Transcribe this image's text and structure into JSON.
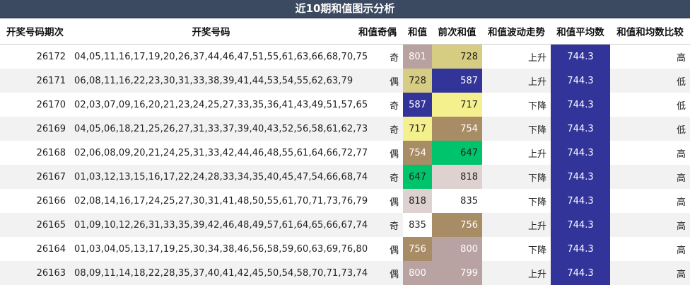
{
  "title": "近10期和值图示分析",
  "headers": {
    "period": "开奖号码期次",
    "numbers": "开奖号码",
    "parity": "和值奇偶",
    "sum": "和值",
    "prev_sum": "前次和值",
    "trend": "和值波动走势",
    "avg": "和值平均数",
    "compare": "和值和均数比较"
  },
  "colors": {
    "title_bg": "#3b4a60",
    "avg_bg": "#33349a",
    "row_alt": "#f2f2f2"
  },
  "rows": [
    {
      "period": "26172",
      "numbers": "04,05,11,16,17,19,20,26,37,44,46,47,51,55,61,63,66,68,70,75",
      "parity": "奇",
      "sum": "801",
      "sum_bg": "#b8a29f",
      "sum_fg": "#ffffff",
      "prev": "728",
      "prev_bg": "#d6cd82",
      "prev_fg": "#222222",
      "trend": "上升",
      "avg": "744.3",
      "compare": "高"
    },
    {
      "period": "26171",
      "numbers": "06,08,11,16,22,23,30,31,33,38,39,41,44,53,54,55,62,63,79",
      "parity": "偶",
      "sum": "728",
      "sum_bg": "#d6cd82",
      "sum_fg": "#222222",
      "prev": "587",
      "prev_bg": "#33349a",
      "prev_fg": "#ffffff",
      "trend": "上升",
      "avg": "744.3",
      "compare": "低"
    },
    {
      "period": "26170",
      "numbers": "02,03,07,09,16,20,21,23,24,25,27,33,35,36,41,43,49,51,57,65",
      "parity": "奇",
      "sum": "587",
      "sum_bg": "#33349a",
      "sum_fg": "#ffffff",
      "prev": "717",
      "prev_bg": "#f4f08e",
      "prev_fg": "#222222",
      "trend": "下降",
      "avg": "744.3",
      "compare": "低"
    },
    {
      "period": "26169",
      "numbers": "04,05,06,18,21,25,26,27,31,33,37,39,40,43,52,56,58,61,62,73",
      "parity": "奇",
      "sum": "717",
      "sum_bg": "#f4f08e",
      "sum_fg": "#222222",
      "prev": "754",
      "prev_bg": "#a88c66",
      "prev_fg": "#ffffff",
      "trend": "下降",
      "avg": "744.3",
      "compare": "低"
    },
    {
      "period": "26168",
      "numbers": "02,06,08,09,20,21,24,25,31,33,42,44,46,48,55,61,64,66,72,77",
      "parity": "偶",
      "sum": "754",
      "sum_bg": "#a88c66",
      "sum_fg": "#ffffff",
      "prev": "647",
      "prev_bg": "#00c46c",
      "prev_fg": "#222222",
      "trend": "上升",
      "avg": "744.3",
      "compare": "高"
    },
    {
      "period": "26167",
      "numbers": "01,03,12,13,15,16,17,22,24,28,33,34,35,40,45,47,54,66,68,74",
      "parity": "奇",
      "sum": "647",
      "sum_bg": "#00c46c",
      "sum_fg": "#222222",
      "prev": "818",
      "prev_bg": "#ddd2cf",
      "prev_fg": "#222222",
      "trend": "下降",
      "avg": "744.3",
      "compare": "高"
    },
    {
      "period": "26166",
      "numbers": "02,08,14,16,17,24,25,27,30,31,41,48,50,55,61,70,71,73,76,79",
      "parity": "偶",
      "sum": "818",
      "sum_bg": "#ddd2cf",
      "sum_fg": "#222222",
      "prev": "835",
      "prev_bg": "#ffffff",
      "prev_fg": "#222222",
      "trend": "下降",
      "avg": "744.3",
      "compare": "高"
    },
    {
      "period": "26165",
      "numbers": "01,09,10,12,26,31,33,35,39,42,46,48,49,57,61,64,65,66,67,74",
      "parity": "奇",
      "sum": "835",
      "sum_bg": "#ffffff",
      "sum_fg": "#222222",
      "prev": "756",
      "prev_bg": "#a88c66",
      "prev_fg": "#ffffff",
      "trend": "上升",
      "avg": "744.3",
      "compare": "高"
    },
    {
      "period": "26164",
      "numbers": "01,03,04,05,13,17,19,25,30,34,38,46,56,58,59,60,63,69,76,80",
      "parity": "偶",
      "sum": "756",
      "sum_bg": "#a88c66",
      "sum_fg": "#ffffff",
      "prev": "800",
      "prev_bg": "#b8a2a2",
      "prev_fg": "#ffffff",
      "trend": "下降",
      "avg": "744.3",
      "compare": "高"
    },
    {
      "period": "26163",
      "numbers": "08,09,11,14,18,22,28,35,37,40,41,42,45,50,54,58,70,71,73,74",
      "parity": "偶",
      "sum": "800",
      "sum_bg": "#b8a2a2",
      "sum_fg": "#ffffff",
      "prev": "799",
      "prev_bg": "#b8a2a2",
      "prev_fg": "#ffffff",
      "trend": "上升",
      "avg": "744.3",
      "compare": "高"
    }
  ]
}
